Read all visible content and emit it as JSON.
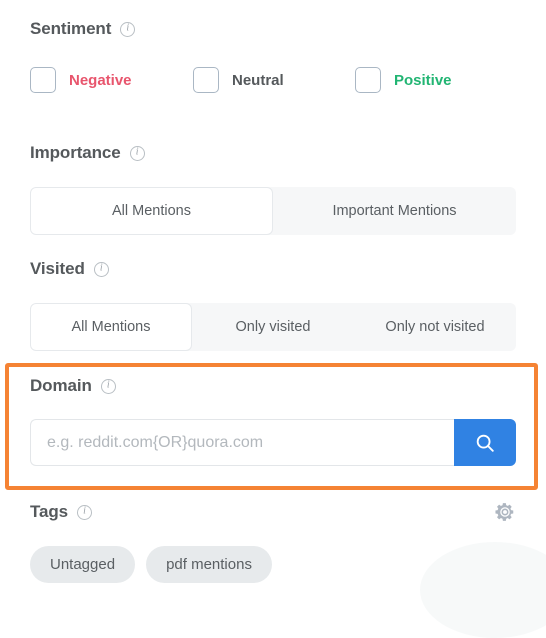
{
  "sentiment": {
    "title": "Sentiment",
    "info_icon": "info-icon",
    "options": [
      {
        "label": "Negative",
        "color": "#e8556d",
        "checked": false
      },
      {
        "label": "Neutral",
        "color": "#55595c",
        "checked": false
      },
      {
        "label": "Positive",
        "color": "#22b573",
        "checked": false
      }
    ]
  },
  "importance": {
    "title": "Importance",
    "info_icon": "info-icon",
    "options": [
      {
        "label": "All Mentions",
        "active": true
      },
      {
        "label": "Important Mentions",
        "active": false
      }
    ]
  },
  "visited": {
    "title": "Visited",
    "info_icon": "info-icon",
    "options": [
      {
        "label": "All Mentions",
        "active": true
      },
      {
        "label": "Only visited",
        "active": false
      },
      {
        "label": "Only not visited",
        "active": false
      }
    ]
  },
  "domain": {
    "title": "Domain",
    "info_icon": "info-icon",
    "input_value": "",
    "input_placeholder": "e.g. reddit.com{OR}quora.com",
    "search_icon": "search-icon",
    "highlight_color": "#f58334",
    "search_button_color": "#3082e3"
  },
  "tags": {
    "title": "Tags",
    "info_icon": "info-icon",
    "settings_icon": "gear-icon",
    "items": [
      {
        "label": "Untagged"
      },
      {
        "label": "pdf mentions"
      }
    ]
  }
}
